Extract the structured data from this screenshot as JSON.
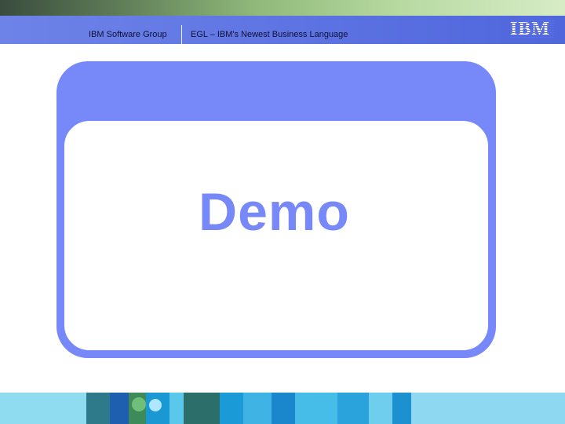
{
  "header": {
    "left_label": "IBM Software Group",
    "right_label": "EGL – IBM's Newest Business Language",
    "logo_text": "IBM"
  },
  "slide": {
    "title": "Demo"
  },
  "colors": {
    "header_blue": "#5a70e0",
    "card_blue": "#7788f8",
    "footer_blue": "#29a9d9"
  }
}
